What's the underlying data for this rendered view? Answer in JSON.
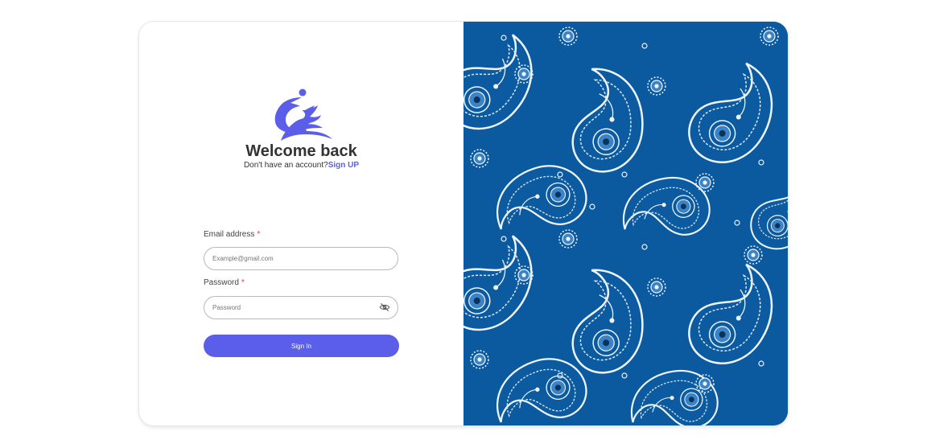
{
  "login": {
    "title": "Welcome back",
    "subtitle_text": "Don't have an account?",
    "signup_link": "Sign UP",
    "email_label": "Email address",
    "email_placeholder": "Example@gmail.com",
    "email_value": "",
    "password_label": "Password",
    "password_placeholder": "Password",
    "password_value": "",
    "required_marker": "*",
    "signin_label": "Sign In"
  },
  "icons": {
    "logo": "brand-logo-icon",
    "eye": "eye-slash-icon"
  },
  "colors": {
    "accent": "#5b5ee8",
    "pattern_background": "#0b5aa0",
    "pattern_line": "#e9f2fb",
    "required": "#e04040"
  }
}
